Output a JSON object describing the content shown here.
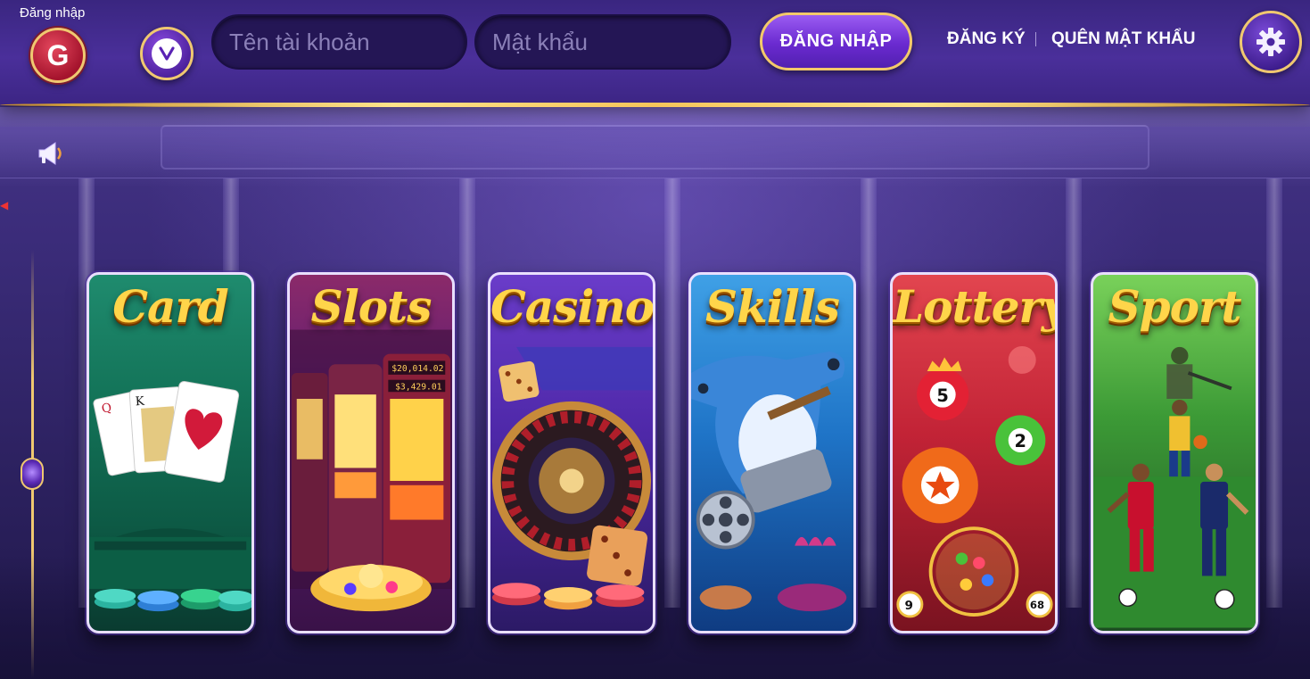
{
  "header": {
    "login_caption": "Đăng nhập",
    "google_letter": "G",
    "username_placeholder": "Tên tài khoản",
    "password_placeholder": "Mật khẩu",
    "login_button": "ĐĂNG NHẬP",
    "register_link": "ĐĂNG KÝ",
    "forgot_link": "QUÊN MẬT KHẨU",
    "settings_icon": "gear-icon",
    "social_icons": [
      "google-icon",
      "v-logo-icon"
    ]
  },
  "marquee": {
    "icon": "speaker-icon"
  },
  "categories": [
    {
      "title": "Card",
      "color": "#137358"
    },
    {
      "title": "Slots",
      "color": "#5d1d72"
    },
    {
      "title": "Casino",
      "color": "#4e28a8"
    },
    {
      "title": "Skills",
      "color": "#1f74c7"
    },
    {
      "title": "Lottery",
      "color": "#c22336"
    },
    {
      "title": "Sport",
      "color": "#3c9a36"
    }
  ],
  "lottery_balls": [
    "5",
    "2",
    "9",
    "68"
  ],
  "slot_machine_amounts": [
    "$20,014.02",
    "$3,429.01",
    "$20,014.02"
  ],
  "theme": {
    "accent_gold": "#f0c870",
    "header_purple": "#4a2f9a"
  }
}
